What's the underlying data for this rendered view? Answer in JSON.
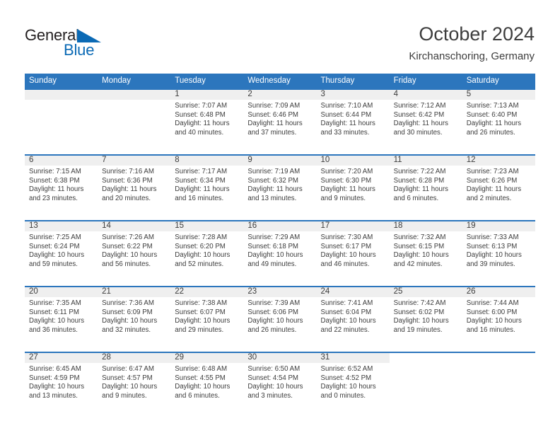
{
  "brand": {
    "name_part1": "General",
    "name_part2": "Blue",
    "triangle_color": "#0b6ab5"
  },
  "header": {
    "title": "October 2024",
    "subtitle": "Kirchanschoring, Germany"
  },
  "theme": {
    "header_row_bg": "#2c76bd",
    "daynum_band_bg": "#efefef",
    "text_color": "#3d3d3d",
    "cell_bg": "#ffffff"
  },
  "weekday_headers": [
    "Sunday",
    "Monday",
    "Tuesday",
    "Wednesday",
    "Thursday",
    "Friday",
    "Saturday"
  ],
  "labels": {
    "sunrise_prefix": "Sunrise:",
    "sunset_prefix": "Sunset:",
    "daylight_prefix": "Daylight:"
  },
  "weeks": [
    [
      {
        "day": "",
        "blank": true,
        "lines": []
      },
      {
        "day": "",
        "blank": true,
        "lines": []
      },
      {
        "day": "1",
        "lines": [
          "Sunrise: 7:07 AM",
          "Sunset: 6:48 PM",
          "Daylight: 11 hours",
          "and 40 minutes."
        ]
      },
      {
        "day": "2",
        "lines": [
          "Sunrise: 7:09 AM",
          "Sunset: 6:46 PM",
          "Daylight: 11 hours",
          "and 37 minutes."
        ]
      },
      {
        "day": "3",
        "lines": [
          "Sunrise: 7:10 AM",
          "Sunset: 6:44 PM",
          "Daylight: 11 hours",
          "and 33 minutes."
        ]
      },
      {
        "day": "4",
        "lines": [
          "Sunrise: 7:12 AM",
          "Sunset: 6:42 PM",
          "Daylight: 11 hours",
          "and 30 minutes."
        ]
      },
      {
        "day": "5",
        "lines": [
          "Sunrise: 7:13 AM",
          "Sunset: 6:40 PM",
          "Daylight: 11 hours",
          "and 26 minutes."
        ]
      }
    ],
    [
      {
        "day": "6",
        "lines": [
          "Sunrise: 7:15 AM",
          "Sunset: 6:38 PM",
          "Daylight: 11 hours",
          "and 23 minutes."
        ]
      },
      {
        "day": "7",
        "lines": [
          "Sunrise: 7:16 AM",
          "Sunset: 6:36 PM",
          "Daylight: 11 hours",
          "and 20 minutes."
        ]
      },
      {
        "day": "8",
        "lines": [
          "Sunrise: 7:17 AM",
          "Sunset: 6:34 PM",
          "Daylight: 11 hours",
          "and 16 minutes."
        ]
      },
      {
        "day": "9",
        "lines": [
          "Sunrise: 7:19 AM",
          "Sunset: 6:32 PM",
          "Daylight: 11 hours",
          "and 13 minutes."
        ]
      },
      {
        "day": "10",
        "lines": [
          "Sunrise: 7:20 AM",
          "Sunset: 6:30 PM",
          "Daylight: 11 hours",
          "and 9 minutes."
        ]
      },
      {
        "day": "11",
        "lines": [
          "Sunrise: 7:22 AM",
          "Sunset: 6:28 PM",
          "Daylight: 11 hours",
          "and 6 minutes."
        ]
      },
      {
        "day": "12",
        "lines": [
          "Sunrise: 7:23 AM",
          "Sunset: 6:26 PM",
          "Daylight: 11 hours",
          "and 2 minutes."
        ]
      }
    ],
    [
      {
        "day": "13",
        "lines": [
          "Sunrise: 7:25 AM",
          "Sunset: 6:24 PM",
          "Daylight: 10 hours",
          "and 59 minutes."
        ]
      },
      {
        "day": "14",
        "lines": [
          "Sunrise: 7:26 AM",
          "Sunset: 6:22 PM",
          "Daylight: 10 hours",
          "and 56 minutes."
        ]
      },
      {
        "day": "15",
        "lines": [
          "Sunrise: 7:28 AM",
          "Sunset: 6:20 PM",
          "Daylight: 10 hours",
          "and 52 minutes."
        ]
      },
      {
        "day": "16",
        "lines": [
          "Sunrise: 7:29 AM",
          "Sunset: 6:18 PM",
          "Daylight: 10 hours",
          "and 49 minutes."
        ]
      },
      {
        "day": "17",
        "lines": [
          "Sunrise: 7:30 AM",
          "Sunset: 6:17 PM",
          "Daylight: 10 hours",
          "and 46 minutes."
        ]
      },
      {
        "day": "18",
        "lines": [
          "Sunrise: 7:32 AM",
          "Sunset: 6:15 PM",
          "Daylight: 10 hours",
          "and 42 minutes."
        ]
      },
      {
        "day": "19",
        "lines": [
          "Sunrise: 7:33 AM",
          "Sunset: 6:13 PM",
          "Daylight: 10 hours",
          "and 39 minutes."
        ]
      }
    ],
    [
      {
        "day": "20",
        "lines": [
          "Sunrise: 7:35 AM",
          "Sunset: 6:11 PM",
          "Daylight: 10 hours",
          "and 36 minutes."
        ]
      },
      {
        "day": "21",
        "lines": [
          "Sunrise: 7:36 AM",
          "Sunset: 6:09 PM",
          "Daylight: 10 hours",
          "and 32 minutes."
        ]
      },
      {
        "day": "22",
        "lines": [
          "Sunrise: 7:38 AM",
          "Sunset: 6:07 PM",
          "Daylight: 10 hours",
          "and 29 minutes."
        ]
      },
      {
        "day": "23",
        "lines": [
          "Sunrise: 7:39 AM",
          "Sunset: 6:06 PM",
          "Daylight: 10 hours",
          "and 26 minutes."
        ]
      },
      {
        "day": "24",
        "lines": [
          "Sunrise: 7:41 AM",
          "Sunset: 6:04 PM",
          "Daylight: 10 hours",
          "and 22 minutes."
        ]
      },
      {
        "day": "25",
        "lines": [
          "Sunrise: 7:42 AM",
          "Sunset: 6:02 PM",
          "Daylight: 10 hours",
          "and 19 minutes."
        ]
      },
      {
        "day": "26",
        "lines": [
          "Sunrise: 7:44 AM",
          "Sunset: 6:00 PM",
          "Daylight: 10 hours",
          "and 16 minutes."
        ]
      }
    ],
    [
      {
        "day": "27",
        "lines": [
          "Sunrise: 6:45 AM",
          "Sunset: 4:59 PM",
          "Daylight: 10 hours",
          "and 13 minutes."
        ]
      },
      {
        "day": "28",
        "lines": [
          "Sunrise: 6:47 AM",
          "Sunset: 4:57 PM",
          "Daylight: 10 hours",
          "and 9 minutes."
        ]
      },
      {
        "day": "29",
        "lines": [
          "Sunrise: 6:48 AM",
          "Sunset: 4:55 PM",
          "Daylight: 10 hours",
          "and 6 minutes."
        ]
      },
      {
        "day": "30",
        "lines": [
          "Sunrise: 6:50 AM",
          "Sunset: 4:54 PM",
          "Daylight: 10 hours",
          "and 3 minutes."
        ]
      },
      {
        "day": "31",
        "lines": [
          "Sunrise: 6:52 AM",
          "Sunset: 4:52 PM",
          "Daylight: 10 hours",
          "and 0 minutes."
        ]
      },
      {
        "day": "",
        "blank": true,
        "lines": []
      },
      {
        "day": "",
        "blank": true,
        "lines": []
      }
    ]
  ]
}
